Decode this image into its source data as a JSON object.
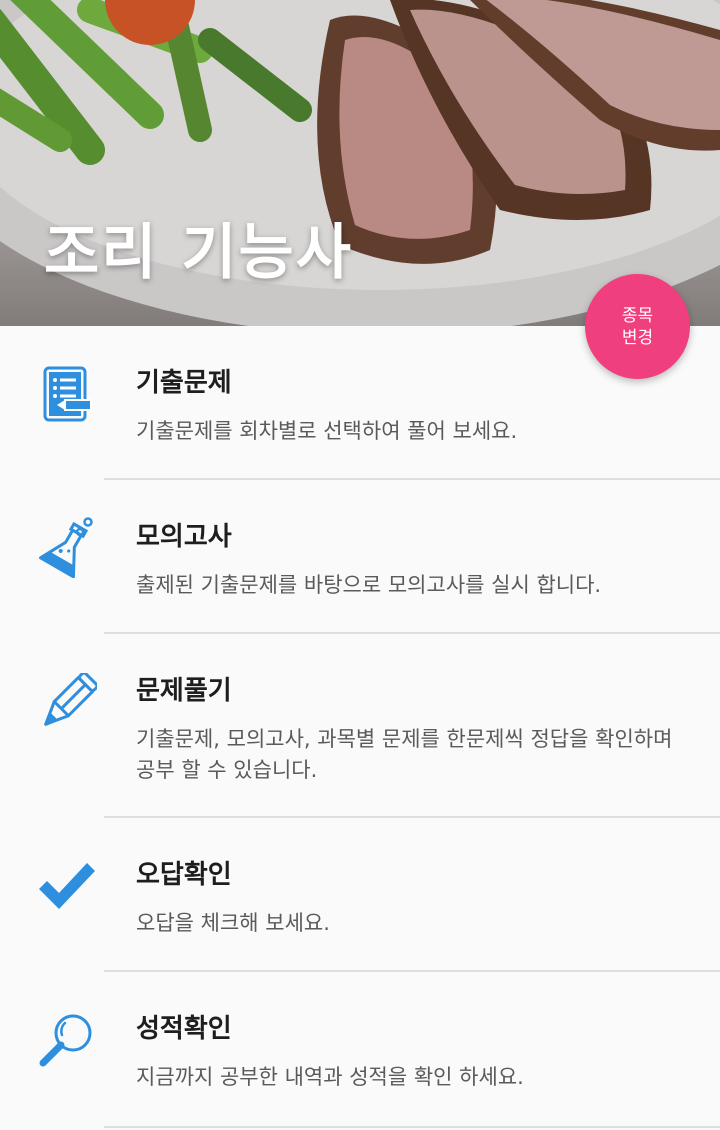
{
  "header": {
    "title": "조리 기능사",
    "change_button": [
      "종목",
      "변경"
    ]
  },
  "accent_color": "#f03f7e",
  "icon_color": "#2f8fdf",
  "menu": [
    {
      "icon": "document-list-icon",
      "title": "기출문제",
      "desc": "기출문제를 회차별로 선택하여 풀어 보세요."
    },
    {
      "icon": "flask-icon",
      "title": "모의고사",
      "desc": "출제된 기출문제를 바탕으로 모의고사를 실시 합니다."
    },
    {
      "icon": "pencil-icon",
      "title": "문제풀기",
      "desc": "기출문제, 모의고사, 과목별 문제를 한문제씩 정답을 확인하며 공부 할 수 있습니다."
    },
    {
      "icon": "checkmark-icon",
      "title": "오답확인",
      "desc": "오답을 체크해 보세요."
    },
    {
      "icon": "magnifier-icon",
      "title": "성적확인",
      "desc": "지금까지 공부한 내역과 성적을 확인 하세요."
    }
  ]
}
